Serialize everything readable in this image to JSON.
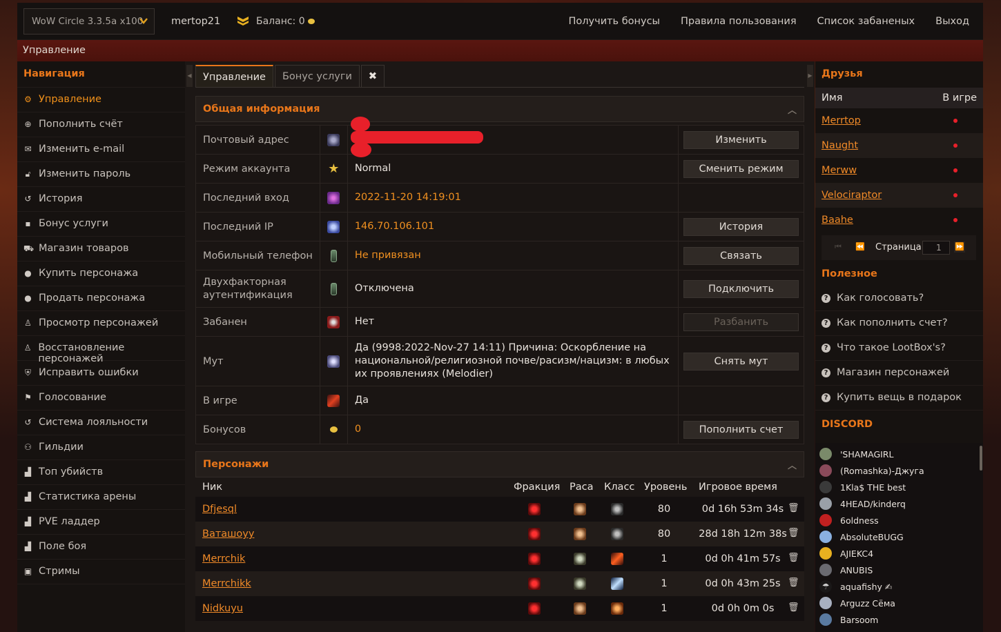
{
  "header": {
    "server": "WoW Circle 3.3.5a x100",
    "username": "mertop21",
    "balance_label": "Баланс: 0",
    "links": [
      "Получить бонусы",
      "Правила пользования",
      "Список забаненых",
      "Выход"
    ]
  },
  "breadcrumb": "Управление",
  "nav": {
    "title": "Навигация",
    "items": [
      {
        "label": "Управление",
        "icon": "gear-icon",
        "active": true
      },
      {
        "label": "Пополнить счёт",
        "icon": "plus-circle-icon"
      },
      {
        "label": "Изменить e-mail",
        "icon": "envelope-icon"
      },
      {
        "label": "Изменить пароль",
        "icon": "lock-icon"
      },
      {
        "label": "История",
        "icon": "history-icon"
      },
      {
        "label": "Бонус услуги",
        "icon": "gift-icon"
      },
      {
        "label": "Магазин товаров",
        "icon": "cart-icon"
      },
      {
        "label": "Купить персонажа",
        "icon": "user-icon"
      },
      {
        "label": "Продать персонажа",
        "icon": "user-icon"
      },
      {
        "label": "Просмотр персонажей",
        "icon": "person-icon"
      },
      {
        "label": "Восстановление персонажей",
        "icon": "person-icon"
      },
      {
        "label": "Исправить ошибки",
        "icon": "shield-icon"
      },
      {
        "label": "Голосование",
        "icon": "flag-icon"
      },
      {
        "label": "Система лояльности",
        "icon": "history-icon"
      },
      {
        "label": "Гильдии",
        "icon": "users-icon"
      },
      {
        "label": "Топ убийств",
        "icon": "chart-icon"
      },
      {
        "label": "Статистика арены",
        "icon": "chart-icon"
      },
      {
        "label": "PVE ладдер",
        "icon": "chart-icon"
      },
      {
        "label": "Поле боя",
        "icon": "chart-icon"
      },
      {
        "label": "Стримы",
        "icon": "twitch-icon"
      }
    ]
  },
  "tabs": [
    "Управление",
    "Бонус услуги",
    "✖"
  ],
  "general": {
    "title": "Общая информация",
    "rows": [
      {
        "label": "Почтовый адрес",
        "value": "",
        "button": "Изменить"
      },
      {
        "label": "Режим аккаунта",
        "value": "Normal",
        "button": "Сменить режим"
      },
      {
        "label": "Последний вход",
        "value": "2022-11-20 14:19:01",
        "button": ""
      },
      {
        "label": "Последний IP",
        "value": "146.70.106.101",
        "button": "История"
      },
      {
        "label": "Мобильный телефон",
        "value": "Не привязан",
        "button": "Связать"
      },
      {
        "label": "Двухфакторная аутентификация",
        "value": "Отключена",
        "button": "Подключить"
      },
      {
        "label": "Забанен",
        "value": "Нет",
        "button": "Разбанить"
      },
      {
        "label": "Мут",
        "value": "Да (9998:2022-Nov-27 14:11) Причина: Оскорбление на национальной/религиозной почве/расизм/нацизм: в любых их проявлениях (Melodier)",
        "button": "Снять мут"
      },
      {
        "label": "В игре",
        "value": "Да",
        "button": ""
      },
      {
        "label": "Бонусов",
        "value": "0",
        "button": "Пополнить счет"
      }
    ]
  },
  "characters": {
    "title": "Персонажи",
    "columns": [
      "Ник",
      "Фракция",
      "Раса",
      "Класс",
      "Уровень",
      "Игровое время"
    ],
    "rows": [
      {
        "nick": "Dfjesql",
        "level": "80",
        "time": "0d 16h 53m 34s"
      },
      {
        "nick": "Ваташоyy",
        "level": "80",
        "time": "28d 18h 12m 38s"
      },
      {
        "nick": "Merrchik",
        "level": "1",
        "time": "0d 0h 41m 57s"
      },
      {
        "nick": "Merrchikk",
        "level": "1",
        "time": "0d 0h 43m 25s"
      },
      {
        "nick": "Nidkuyu",
        "level": "1",
        "time": "0d 0h 0m 0s"
      }
    ]
  },
  "friends": {
    "title": "Друзья",
    "col_name": "Имя",
    "col_ingame": "В игре",
    "list": [
      "Merrtop",
      "Naught",
      "Merww",
      "Velociraptor",
      "Baahe"
    ],
    "page_label": "Страница",
    "page_value": "1"
  },
  "useful": {
    "title": "Полезное",
    "items": [
      "Как голосовать?",
      "Как пополнить счет?",
      "Что такое LootBox's?",
      "Магазин персонажей",
      "Купить вещь в подарок"
    ]
  },
  "discord": {
    "title": "DISCORD",
    "members": [
      "'SHAMAGIRL",
      "(Romashka)-Джуга",
      "1Kla$ THE best",
      "4HEAD/kinderq",
      "6oldness",
      "AbsoluteBUGG",
      "AJIEKC4",
      "ANUBIS",
      "aquafishy ✍",
      "Arguzz Сёма",
      "Barsoom"
    ]
  }
}
